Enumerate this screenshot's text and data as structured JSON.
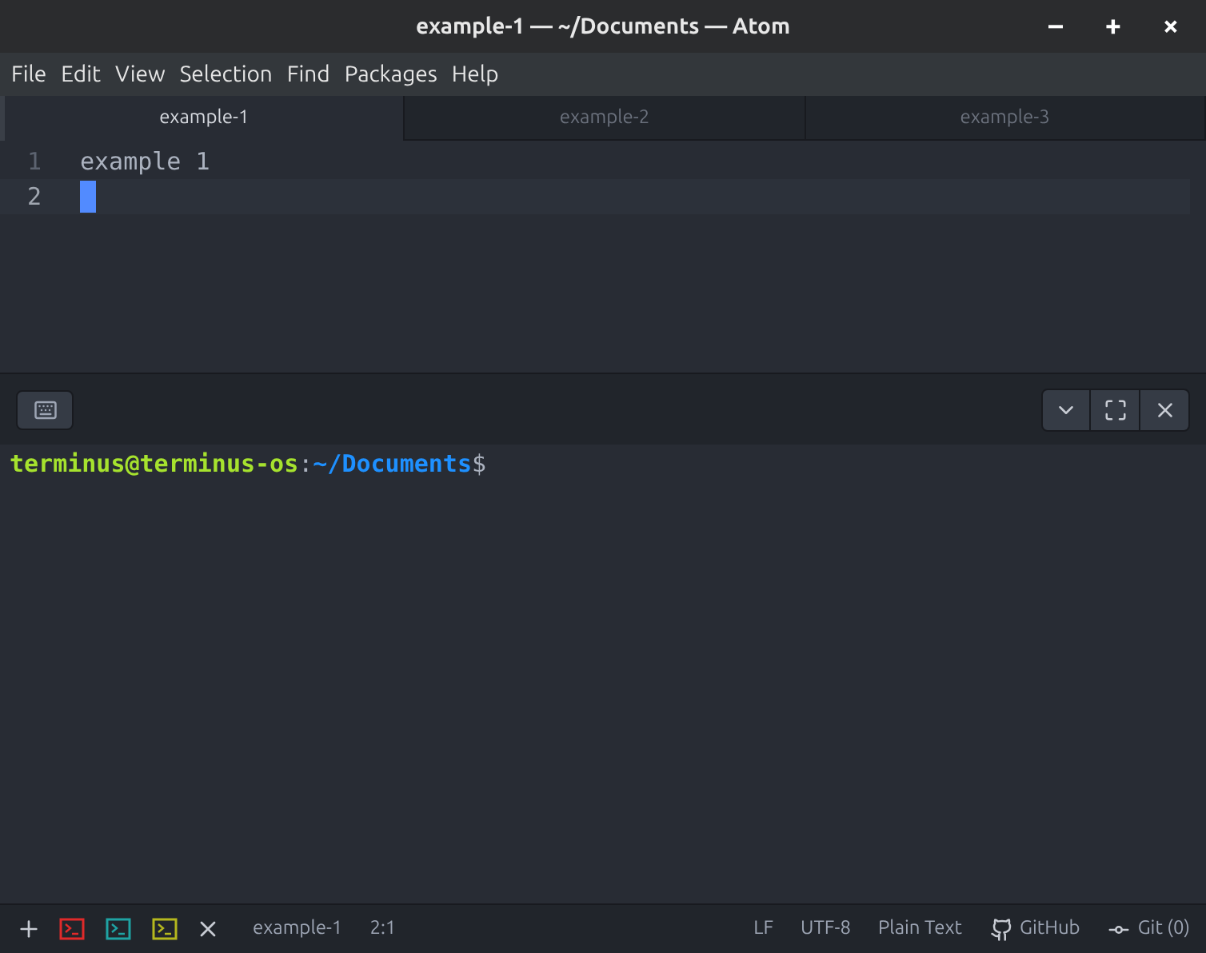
{
  "window": {
    "title": "example-1 — ~/Documents — Atom",
    "controls": [
      "–",
      "+",
      "×"
    ]
  },
  "menu": [
    "File",
    "Edit",
    "View",
    "Selection",
    "Find",
    "Packages",
    "Help"
  ],
  "tabs": [
    {
      "label": "example-1",
      "selected": true
    },
    {
      "label": "example-2",
      "selected": false
    },
    {
      "label": "example-3",
      "selected": false
    }
  ],
  "editor": {
    "lines": [
      {
        "number": "1",
        "text": "example 1",
        "cursor": false
      },
      {
        "number": "2",
        "cursor": true
      }
    ]
  },
  "terminal": {
    "user_host": "terminus@terminus-os",
    "separator": ":",
    "path": "~/Documents",
    "prompt": "$"
  },
  "status_bar": {
    "terminals": [
      {
        "color": "#e02a2a"
      },
      {
        "color": "#1fa3a3"
      },
      {
        "color": "#b5b81e"
      }
    ],
    "file": "example-1",
    "position": "2:1",
    "line_ending": "LF",
    "encoding": "UTF-8",
    "grammar": "Plain Text",
    "github": "GitHub",
    "git": "Git (0)"
  }
}
